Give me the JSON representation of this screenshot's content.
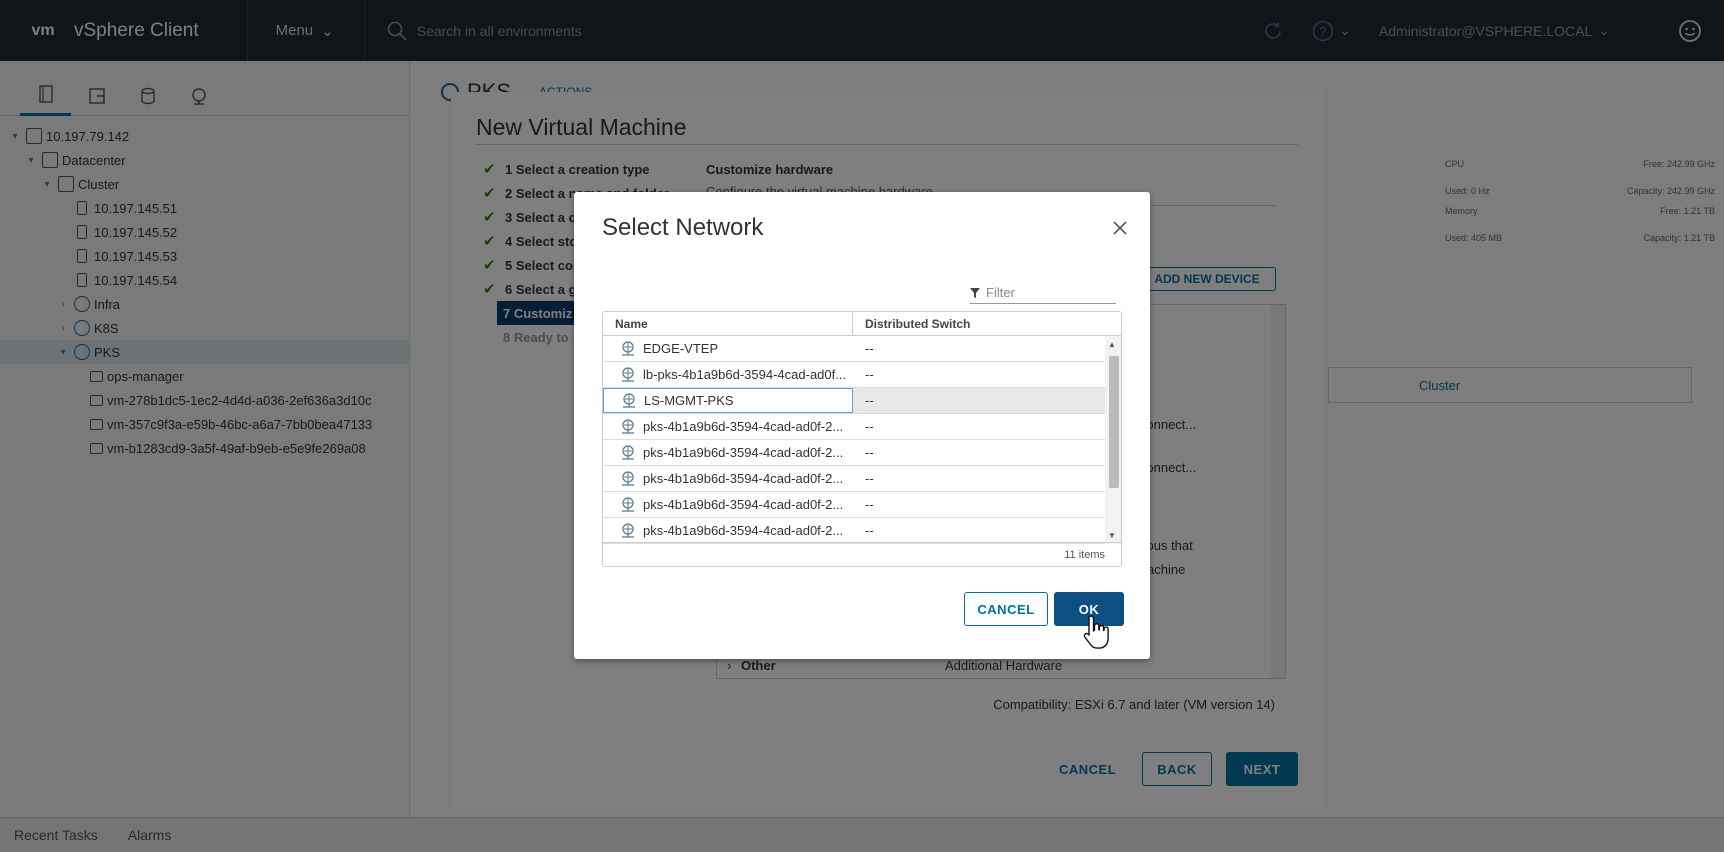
{
  "header": {
    "logo": "vm",
    "app_title": "vSphere Client",
    "menu_label": "Menu",
    "search_placeholder": "Search in all environments",
    "user": "Administrator@VSPHERE.LOCAL"
  },
  "tree": [
    {
      "label": "10.197.79.142",
      "indent": 0,
      "twist": "▾",
      "icon": "vcenter"
    },
    {
      "label": "Datacenter",
      "indent": 1,
      "twist": "▾",
      "icon": "datacenter"
    },
    {
      "label": "Cluster",
      "indent": 2,
      "twist": "▾",
      "icon": "cluster"
    },
    {
      "label": "10.197.145.51",
      "indent": 3,
      "twist": "",
      "icon": "host"
    },
    {
      "label": "10.197.145.52",
      "indent": 3,
      "twist": "",
      "icon": "host"
    },
    {
      "label": "10.197.145.53",
      "indent": 3,
      "twist": "",
      "icon": "host"
    },
    {
      "label": "10.197.145.54",
      "indent": 3,
      "twist": "",
      "icon": "host"
    },
    {
      "label": "Infra",
      "indent": 3,
      "twist": "›",
      "icon": "rp"
    },
    {
      "label": "K8S",
      "indent": 3,
      "twist": "›",
      "icon": "rp"
    },
    {
      "label": "PKS",
      "indent": 3,
      "twist": "▾",
      "icon": "rp",
      "selected": true
    },
    {
      "label": "ops-manager",
      "indent": 4,
      "twist": "",
      "icon": "vm"
    },
    {
      "label": "vm-278b1dc5-1ec2-4d4d-a036-2ef636a3d10c",
      "indent": 4,
      "twist": "",
      "icon": "vm"
    },
    {
      "label": "vm-357c9f3a-e59b-46bc-a6a7-7bb0bea47133",
      "indent": 4,
      "twist": "",
      "icon": "vm"
    },
    {
      "label": "vm-b1283cd9-3a5f-49af-b9eb-e5e9fe269a08",
      "indent": 4,
      "twist": "",
      "icon": "vm"
    }
  ],
  "bottom": {
    "recent_tasks": "Recent Tasks",
    "alarms": "Alarms"
  },
  "wizard": {
    "title": "New Virtual Machine",
    "steps": [
      {
        "label": "1 Select a creation type",
        "done": true
      },
      {
        "label": "2 Select a name and folder",
        "done": true
      },
      {
        "label": "3 Select a c",
        "done": true
      },
      {
        "label": "4 Select sto",
        "done": true
      },
      {
        "label": "5 Select co",
        "done": true
      },
      {
        "label": "6 Select a g",
        "done": true
      },
      {
        "label": "7 Customiz",
        "current": true
      },
      {
        "label": "8 Ready to",
        "todo": true
      }
    ],
    "content_title": "Customize hardware",
    "content_sub": "Configure the virtual machine hardware",
    "add_device": "ADD NEW DEVICE",
    "other_label": "Other",
    "other_value": "Additional Hardware",
    "compat": "Compatibility: ESXi 6.7 and later (VM version 14)",
    "cancel": "CANCEL",
    "back": "BACK",
    "next": "NEXT"
  },
  "dialog": {
    "title": "Select Network",
    "filter_placeholder": "Filter",
    "col_name": "Name",
    "col_switch": "Distributed Switch",
    "rows": [
      {
        "name": "EDGE-VTEP",
        "switch": "--"
      },
      {
        "name": "lb-pks-4b1a9b6d-3594-4cad-ad0f...",
        "switch": "--"
      },
      {
        "name": "LS-MGMT-PKS",
        "switch": "--",
        "selected": true
      },
      {
        "name": "pks-4b1a9b6d-3594-4cad-ad0f-2...",
        "switch": "--"
      },
      {
        "name": "pks-4b1a9b6d-3594-4cad-ad0f-2...",
        "switch": "--"
      },
      {
        "name": "pks-4b1a9b6d-3594-4cad-ad0f-2...",
        "switch": "--"
      },
      {
        "name": "pks-4b1a9b6d-3594-4cad-ad0f-2...",
        "switch": "--"
      },
      {
        "name": "pks-4b1a9b6d-3594-4cad-ad0f-2...",
        "switch": "--"
      },
      {
        "name": "",
        "switch": ""
      }
    ],
    "item_count": "11 items",
    "cancel": "CANCEL",
    "ok": "OK"
  },
  "background": {
    "pks_title": "PKS",
    "actions": "ACTIONS",
    "cpu": "CPU",
    "cpu_free": "Free: 242.99 GHz",
    "cpu_used": "Used: 0 Hz",
    "cpu_cap": "Capacity: 242.99 GHz",
    "memory": "Memory",
    "mem_free": "Free: 1.21 TB",
    "mem_used": "Used: 405 MB",
    "mem_cap": "Capacity: 1.21 TB",
    "cluster_link": "Cluster",
    "connect1": "Connect...",
    "connect2": "Connect...",
    "bus_text": "l bus that",
    "machine_text": "achine"
  }
}
